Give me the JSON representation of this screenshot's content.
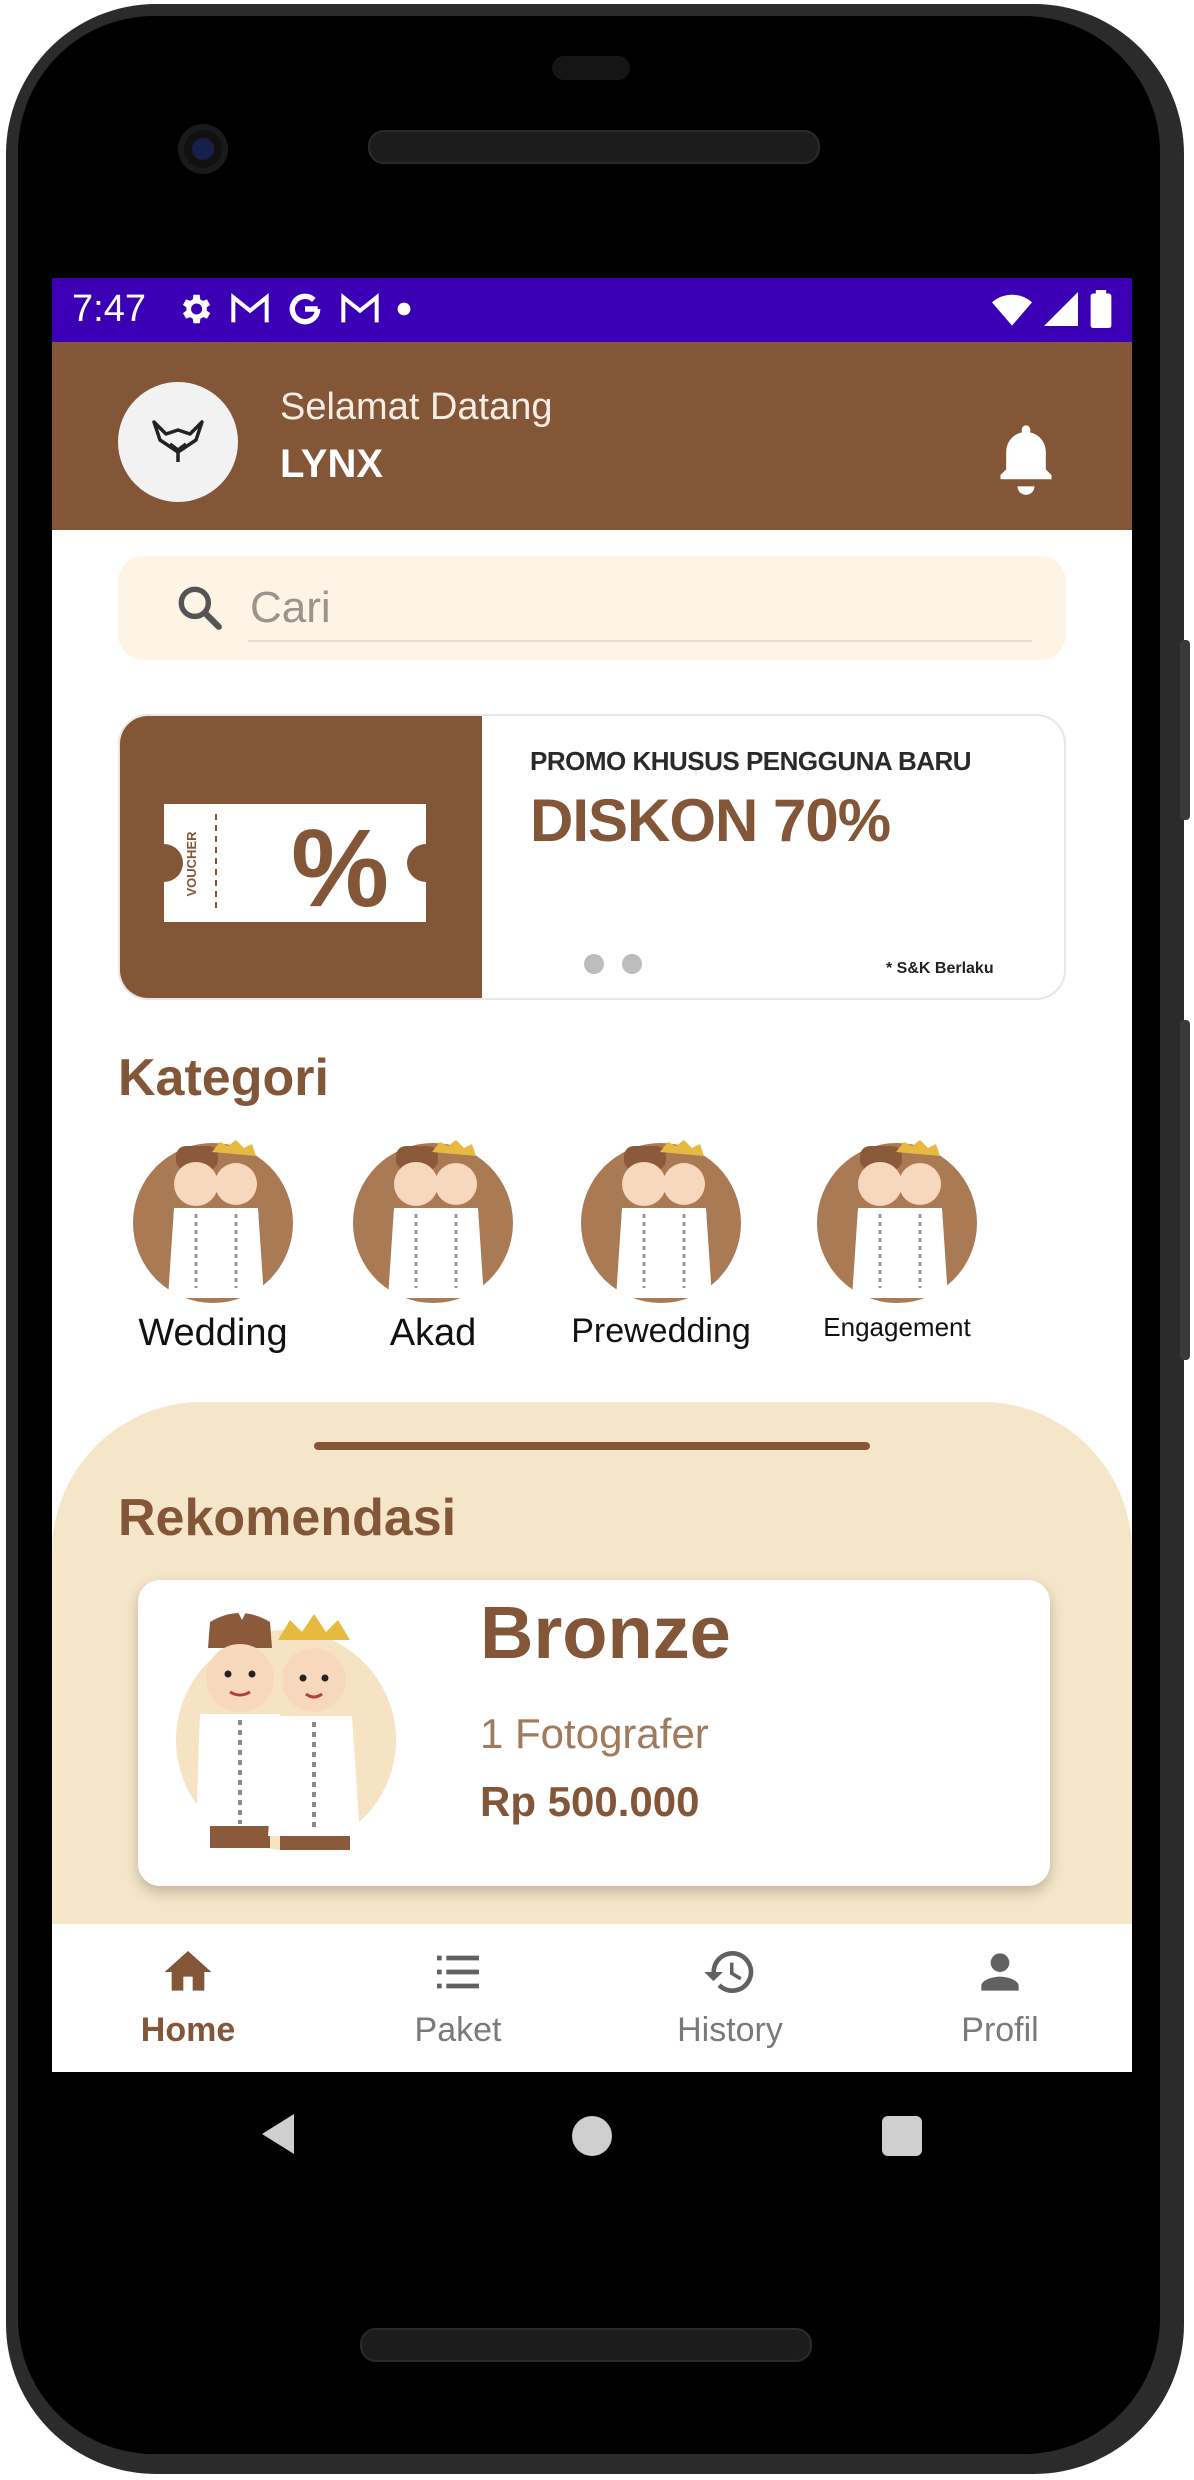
{
  "status_bar": {
    "time": "7:47",
    "left_icons": [
      "gear-icon",
      "gmail-icon",
      "google-icon",
      "gmail-icon",
      "dot-icon"
    ],
    "right_icons": [
      "wifi-icon",
      "signal-icon",
      "battery-icon"
    ],
    "background": "#3b00b6"
  },
  "header": {
    "greeting": "Selamat Datang",
    "username": "LYNX",
    "avatar_icon": "fox-logo-icon",
    "notification_icon": "bell-icon",
    "background": "#835638"
  },
  "search": {
    "placeholder": "Cari",
    "value": ""
  },
  "banner": {
    "voucher_text": "VOUCHER",
    "subtitle": "PROMO KHUSUS PENGGUNA BARU",
    "title": "DISKON 70%",
    "note": "* S&K Berlaku",
    "pages": 2
  },
  "categories": {
    "title": "Kategori",
    "items": [
      {
        "label": "Wedding"
      },
      {
        "label": "Akad"
      },
      {
        "label": "Prewedding"
      },
      {
        "label": "Engagement"
      }
    ]
  },
  "recommendations": {
    "title": "Rekomendasi",
    "items": [
      {
        "name": "Bronze",
        "subtitle": "1 Fotografer",
        "price": "Rp 500.000"
      }
    ]
  },
  "bottom_nav": {
    "items": [
      {
        "label": "Home",
        "icon": "home-icon",
        "active": true
      },
      {
        "label": "Paket",
        "icon": "list-icon",
        "active": false
      },
      {
        "label": "History",
        "icon": "history-icon",
        "active": false
      },
      {
        "label": "Profil",
        "icon": "person-icon",
        "active": false
      }
    ]
  },
  "colors": {
    "accent": "#835638",
    "panel": "#f5e6c9",
    "search_bg": "#fdf4e6"
  }
}
